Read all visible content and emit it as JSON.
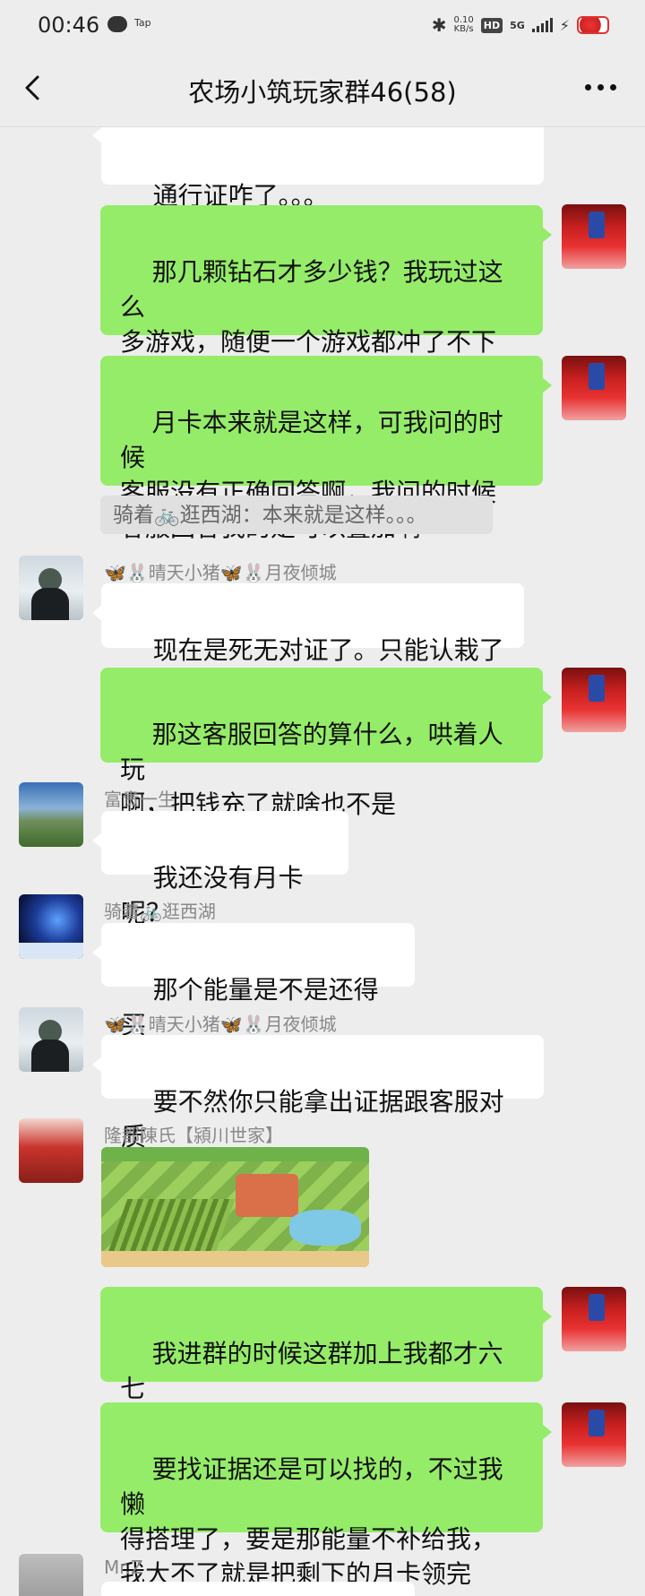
{
  "status_bar": {
    "time": "00:46",
    "tap_label": "Tap",
    "speed_value": "0.10",
    "speed_unit": "KB/s",
    "hd": "HD",
    "network": "5G"
  },
  "header": {
    "title": "农场小筑玩家群46(58)"
  },
  "messages": [
    {
      "sender": "me",
      "text": "那几颗钻石才多少钱？我玩过这么\n多游戏，随便一个游戏都冲了不下\n三百"
    },
    {
      "sender": "me",
      "text": "月卡本来就是这样，可我问的时候\n客服没有正确回答啊，我问的时候\n客服回答我的是可以叠加啊"
    },
    {
      "quote": "骑着🚲逛西湖：本来就是这样。。。"
    },
    {
      "sender": "🦋🐰晴天小猪🦋🐰月夜倾城",
      "text": "现在是死无对证了。只能认栽了"
    },
    {
      "sender": "me",
      "text": "那这客服回答的算什么，哄着人玩\n啊，把钱充了就啥也不是"
    },
    {
      "sender": "富贵一生",
      "text": "我还没有月卡呢？"
    },
    {
      "sender": "骑着🚲逛西湖",
      "text": "那个能量是不是还得买"
    },
    {
      "sender": "🦋🐰晴天小猪🦋🐰月夜倾城",
      "text": "要不然你只能拿出证据跟客服对质"
    },
    {
      "sender": "隆都陳氏【潁川世家】",
      "text": ""
    },
    {
      "sender": "me",
      "text": "我进群的时候这群加上我都才六七\n个人"
    },
    {
      "sender": "me",
      "text": "要找证据还是可以找的，不过我懒\n得搭理了，要是那能量不补给我，\n我大不了就是把剩下的月卡领完"
    },
    {
      "sender": "Mr.Z",
      "text": ""
    }
  ],
  "top_partial_text": "通行证咋了。。。"
}
